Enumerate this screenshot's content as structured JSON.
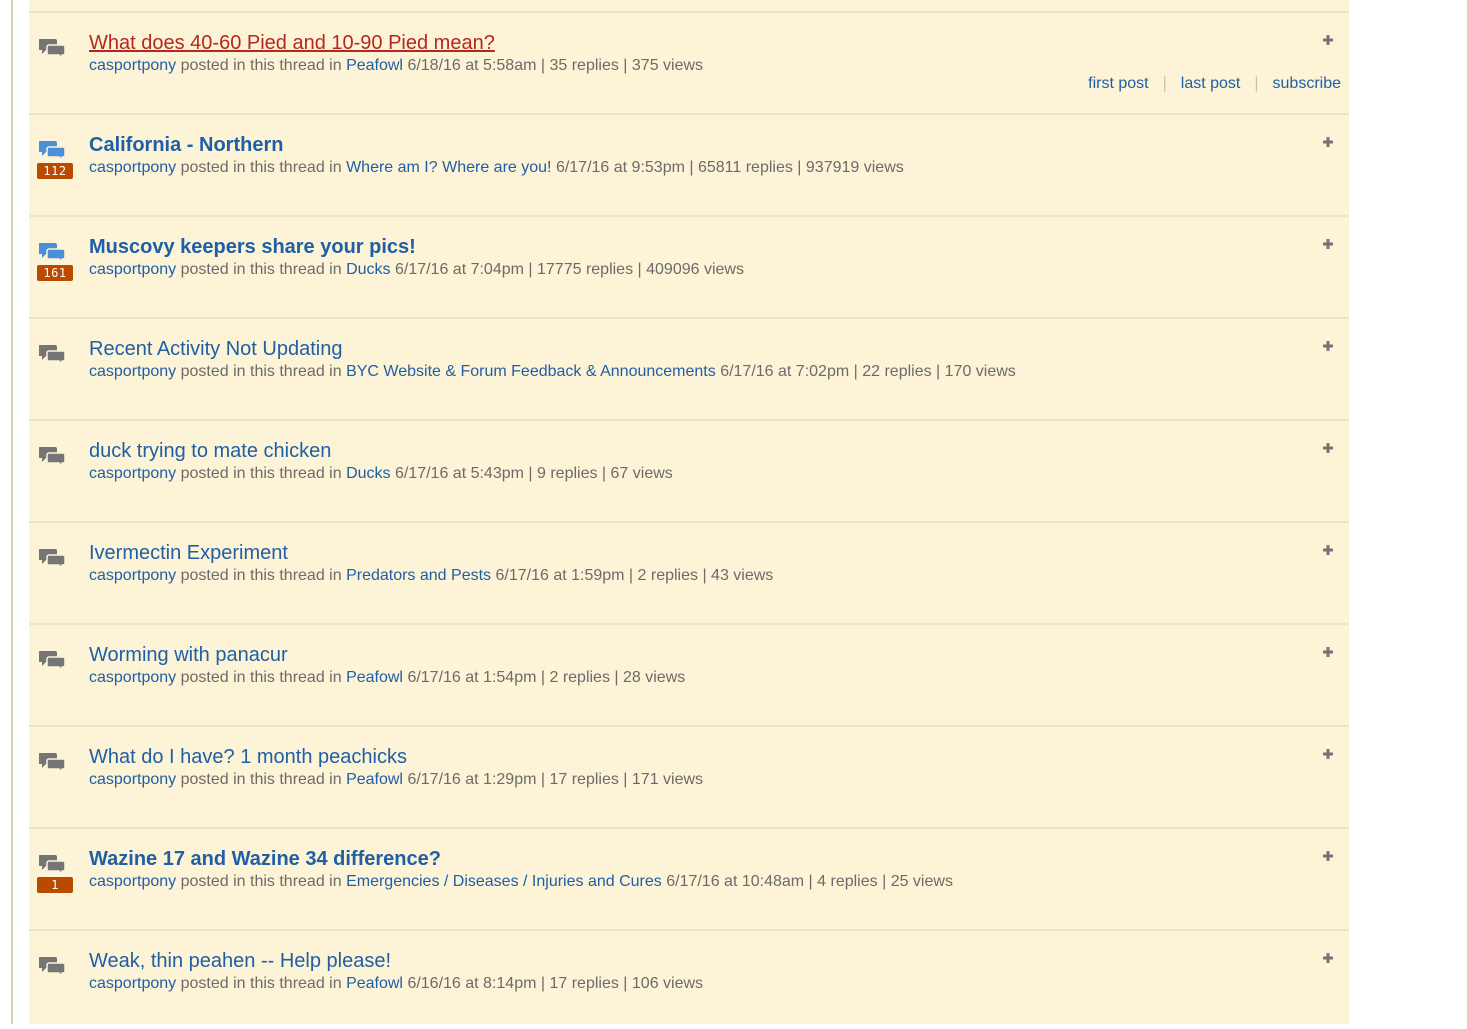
{
  "common": {
    "author": "casportpony",
    "posted_text": " posted in this thread in ",
    "pipe": " | "
  },
  "actions": {
    "first_post": "first post",
    "last_post": "last post",
    "subscribe": "subscribe",
    "separator": "|"
  },
  "colors": {
    "row_background": "#fdf3d6",
    "link": "#1f5fa6",
    "hover_link": "#b5281f",
    "badge": "#b94a00",
    "icon_read": "#757575",
    "icon_unread": "#4b8fd6"
  },
  "threads": [
    {
      "title": "What does 40-60 Pied and 10-90 Pied mean?",
      "forum": "Peafowl",
      "date": "6/18/16 at 5:58am",
      "replies": "35 replies",
      "views": "375 views",
      "badge": "",
      "unread": false,
      "bold": false,
      "hover": true
    },
    {
      "title": "California - Northern",
      "forum": "Where am I? Where are you!",
      "date": "6/17/16 at 9:53pm",
      "replies": "65811 replies",
      "views": "937919 views",
      "badge": "112",
      "unread": true,
      "bold": true,
      "hover": false
    },
    {
      "title": "Muscovy keepers share your pics!",
      "forum": "Ducks",
      "date": "6/17/16 at 7:04pm",
      "replies": "17775 replies",
      "views": "409096 views",
      "badge": "161",
      "unread": true,
      "bold": true,
      "hover": false
    },
    {
      "title": "Recent Activity Not Updating",
      "forum": "BYC Website & Forum Feedback & Announcements",
      "date": "6/17/16 at 7:02pm",
      "replies": "22 replies",
      "views": "170 views",
      "badge": "",
      "unread": false,
      "bold": false,
      "hover": false
    },
    {
      "title": "duck trying to mate chicken",
      "forum": "Ducks",
      "date": "6/17/16 at 5:43pm",
      "replies": "9 replies",
      "views": "67 views",
      "badge": "",
      "unread": false,
      "bold": false,
      "hover": false
    },
    {
      "title": "Ivermectin Experiment",
      "forum": "Predators and Pests",
      "date": "6/17/16 at 1:59pm",
      "replies": "2 replies",
      "views": "43 views",
      "badge": "",
      "unread": false,
      "bold": false,
      "hover": false
    },
    {
      "title": "Worming with panacur",
      "forum": "Peafowl",
      "date": "6/17/16 at 1:54pm",
      "replies": "2 replies",
      "views": "28 views",
      "badge": "",
      "unread": false,
      "bold": false,
      "hover": false
    },
    {
      "title": "What do I have? 1 month peachicks",
      "forum": "Peafowl",
      "date": "6/17/16 at 1:29pm",
      "replies": "17 replies",
      "views": "171 views",
      "badge": "",
      "unread": false,
      "bold": false,
      "hover": false
    },
    {
      "title": "Wazine 17 and Wazine 34 difference?",
      "forum": "Emergencies / Diseases / Injuries and Cures",
      "date": "6/17/16 at 10:48am",
      "replies": "4 replies",
      "views": "25 views",
      "badge": "1",
      "unread": false,
      "bold": true,
      "hover": false
    },
    {
      "title": "Weak, thin peahen -- Help please!",
      "forum": "Peafowl",
      "date": "6/16/16 at 8:14pm",
      "replies": "17 replies",
      "views": "106 views",
      "badge": "",
      "unread": false,
      "bold": false,
      "hover": false
    }
  ]
}
